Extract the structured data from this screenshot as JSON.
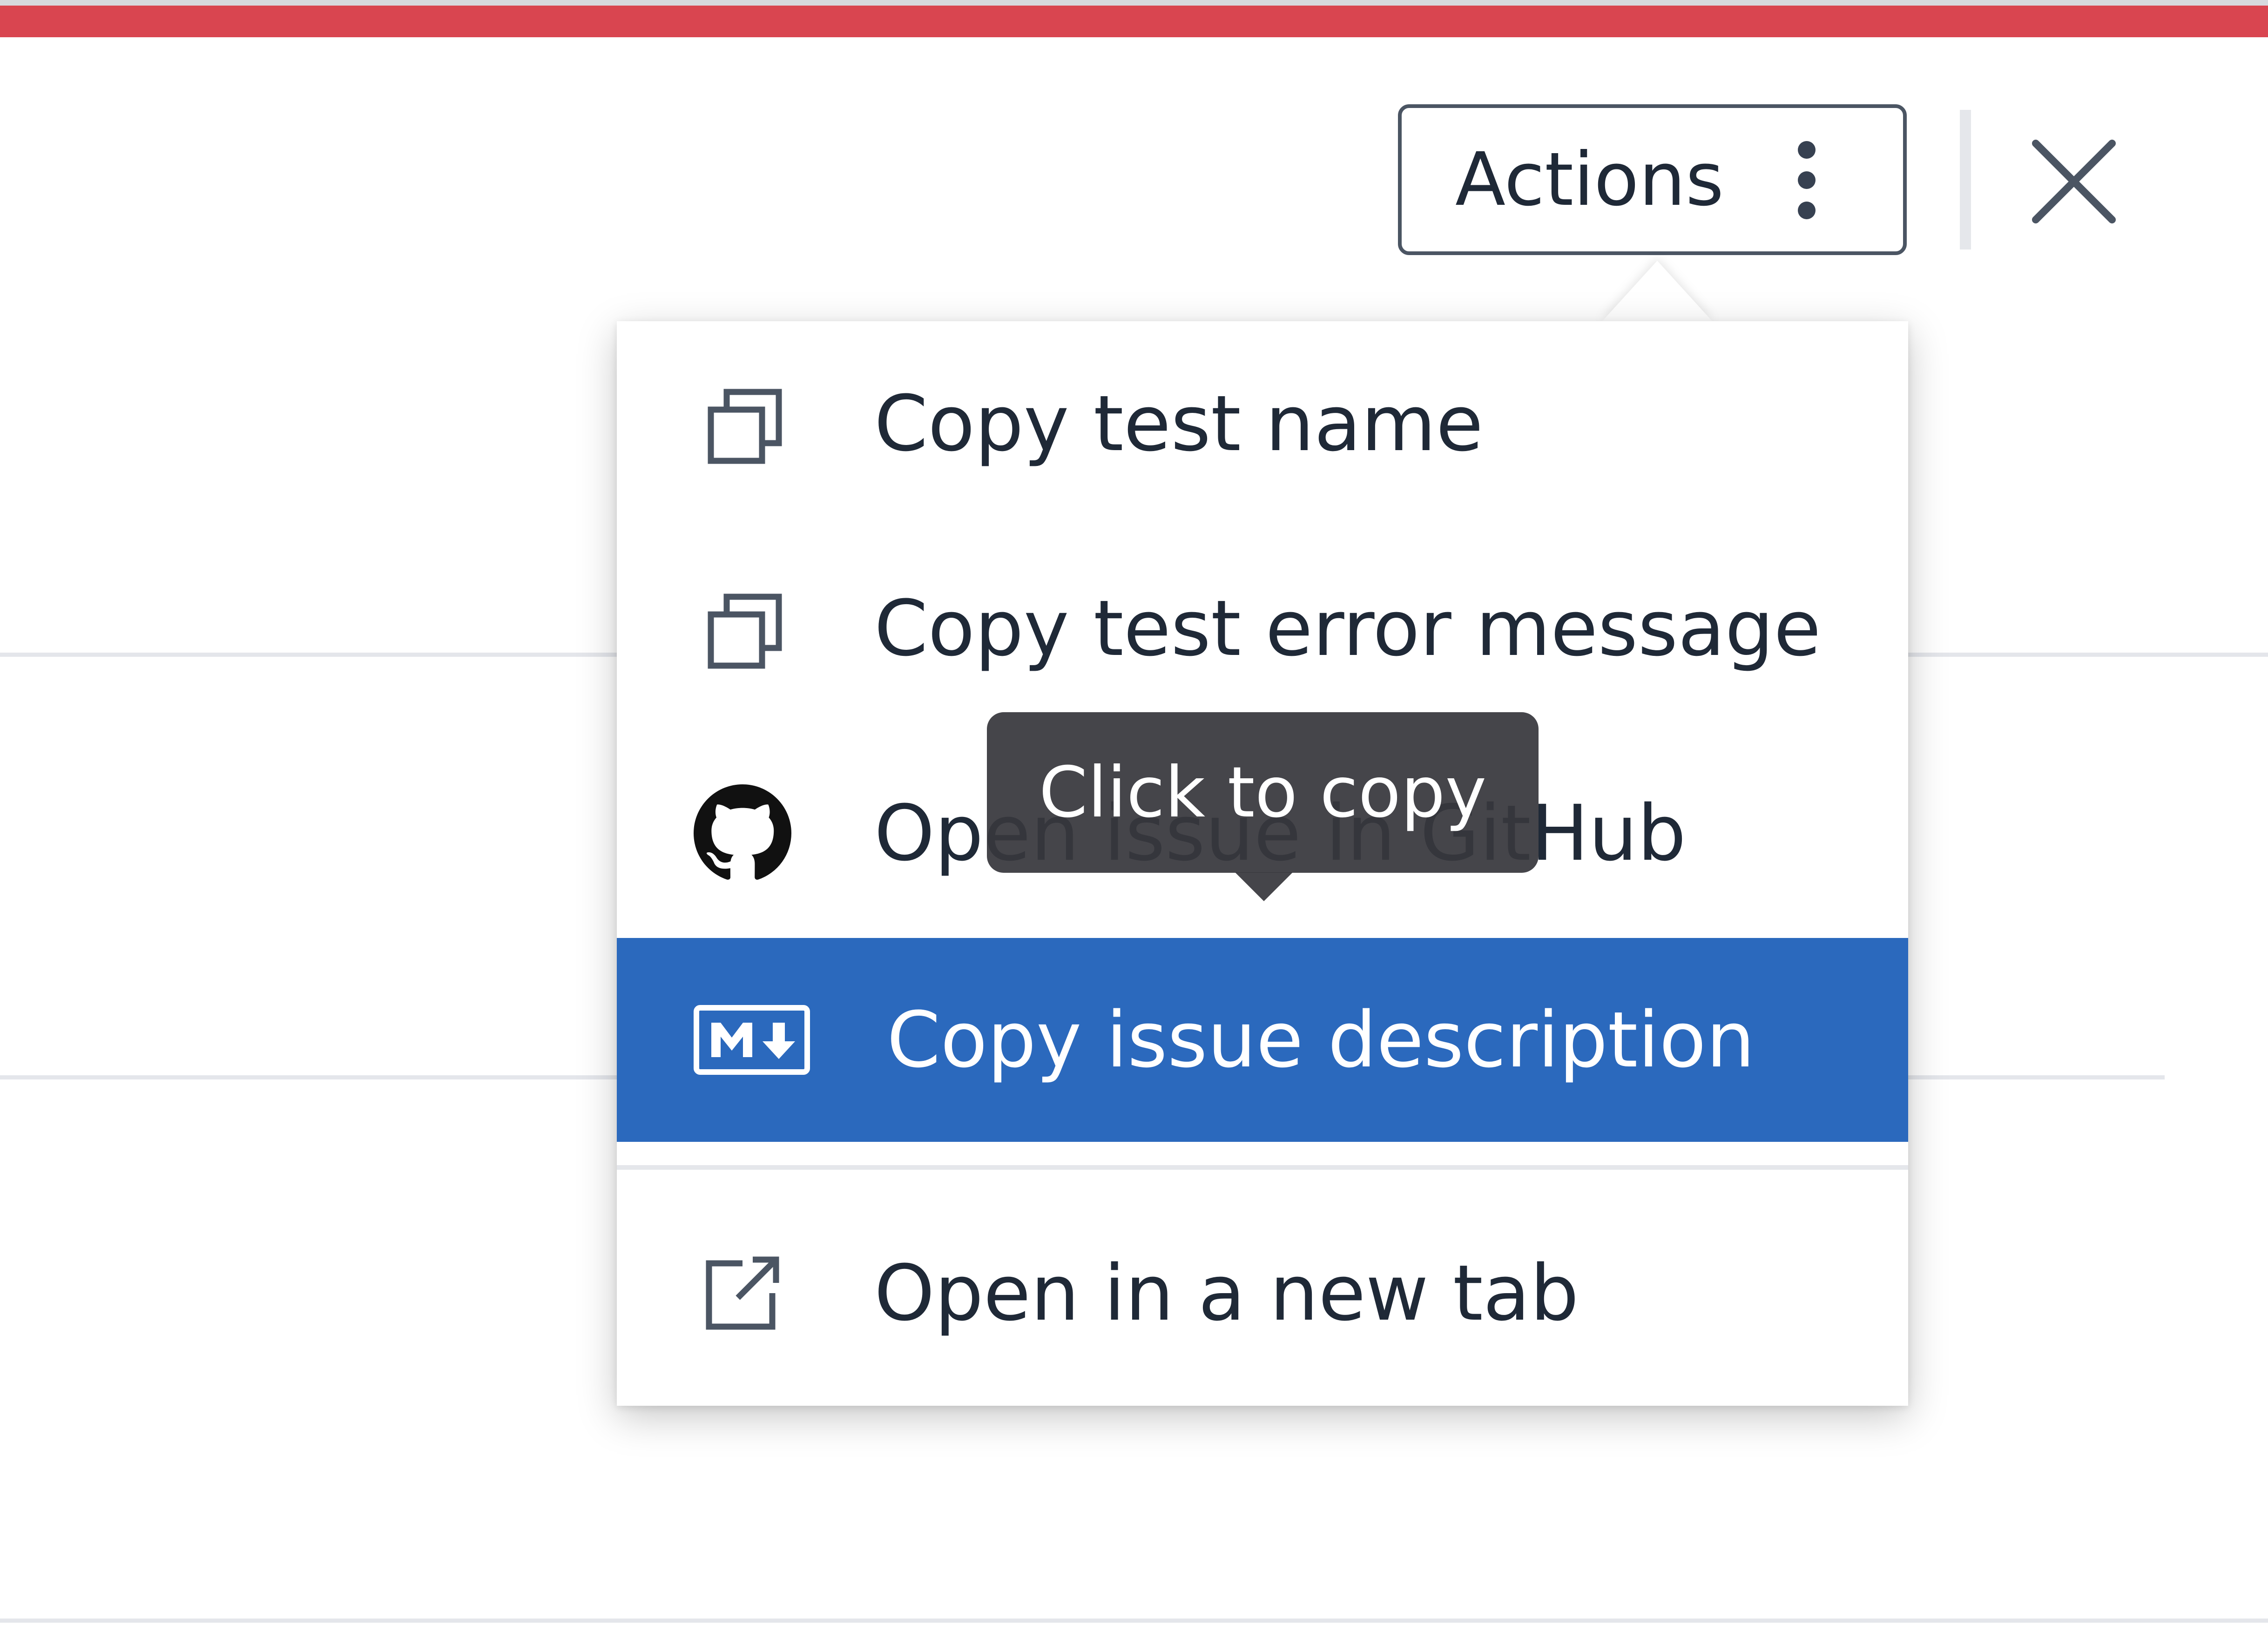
{
  "header": {
    "status_color": "#d94550",
    "actions_label": "Actions",
    "actions_icon": "kebab-vertical-icon",
    "close_icon": "close-icon"
  },
  "menu": {
    "items": [
      {
        "label": "Copy test name",
        "icon": "copy-icon"
      },
      {
        "label": "Copy test error message",
        "icon": "copy-icon"
      },
      {
        "label": "Open issue in GitHub",
        "icon": "github-icon"
      },
      {
        "label": "Copy issue description",
        "icon": "markdown-icon",
        "highlighted": true
      },
      {
        "label": "Open in a new tab",
        "icon": "external-link-icon"
      }
    ],
    "highlight_color": "#2b69bd"
  },
  "tooltip": {
    "text": "Click to copy"
  }
}
